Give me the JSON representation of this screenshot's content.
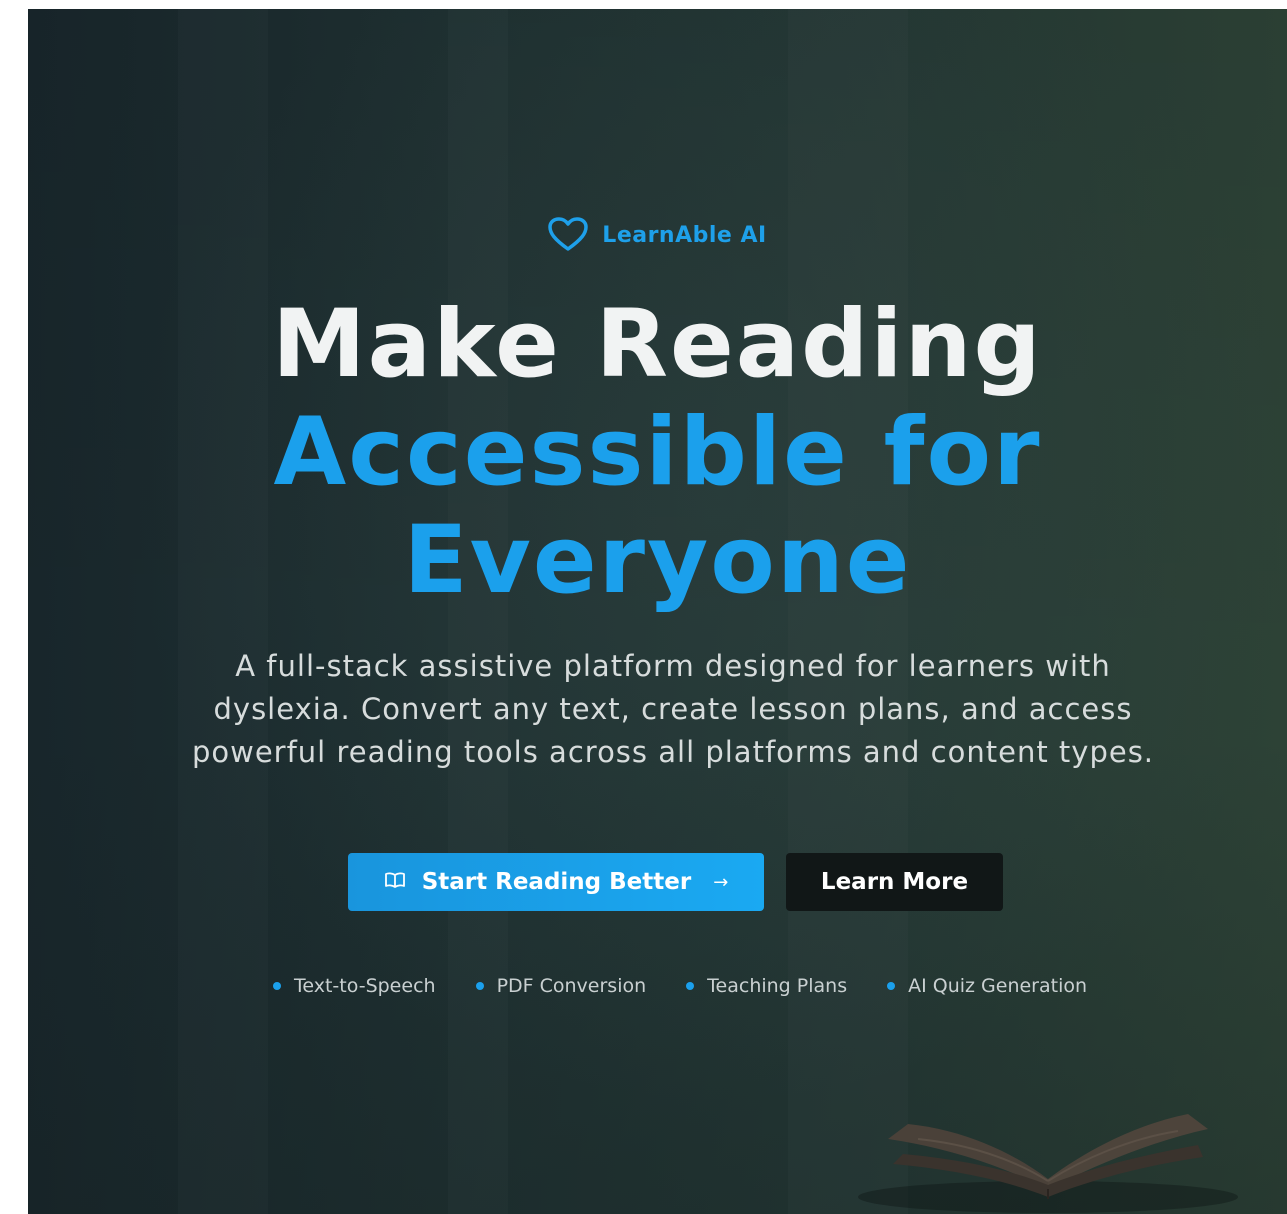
{
  "brand": {
    "name": "LearnAble AI",
    "icon": "heart-icon"
  },
  "hero": {
    "headline_line1": "Make Reading",
    "headline_line2": "Accessible for",
    "headline_line3": "Everyone",
    "subtitle": "A full-stack assistive platform designed for learners with dyslexia. Convert any text, create lesson plans, and access powerful reading tools across all platforms and content types."
  },
  "actions": {
    "primary_label": "Start Reading Better",
    "primary_icon": "book-open-icon",
    "primary_arrow": "→",
    "secondary_label": "Learn More"
  },
  "features": [
    {
      "label": "Text-to-Speech"
    },
    {
      "label": "PDF Conversion"
    },
    {
      "label": "Teaching Plans"
    },
    {
      "label": "AI Quiz Generation"
    }
  ],
  "colors": {
    "accent": "#1ba0ec",
    "background_dark": "#1f3132",
    "heading_white": "#f1f3f3",
    "button_dark": "#111717"
  }
}
